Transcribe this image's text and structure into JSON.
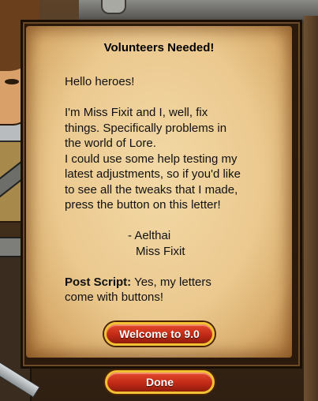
{
  "letter": {
    "title": "Volunteers Needed!",
    "greeting": "Hello heroes!",
    "paragraph1": [
      "I'm Miss Fixit and I, well, fix",
      "things.  Specifically problems in",
      "the world of Lore.",
      "I could use some help testing my",
      "latest adjustments, so if you'd like",
      "to see all the tweaks that I made,",
      "press the button on this letter!"
    ],
    "signoff_line1": "- Aelthai",
    "signoff_line2": "Miss Fixit",
    "ps_label": "Post Script:",
    "ps_text_line1": " Yes, my letters",
    "ps_text_line2": "come with buttons!"
  },
  "buttons": {
    "welcome_label": "Welcome to 9.0",
    "done_label": "Done"
  },
  "colors": {
    "parchment": "#ebc98f",
    "button_red": "#c22a16",
    "button_border_gold": "#f2c232"
  }
}
